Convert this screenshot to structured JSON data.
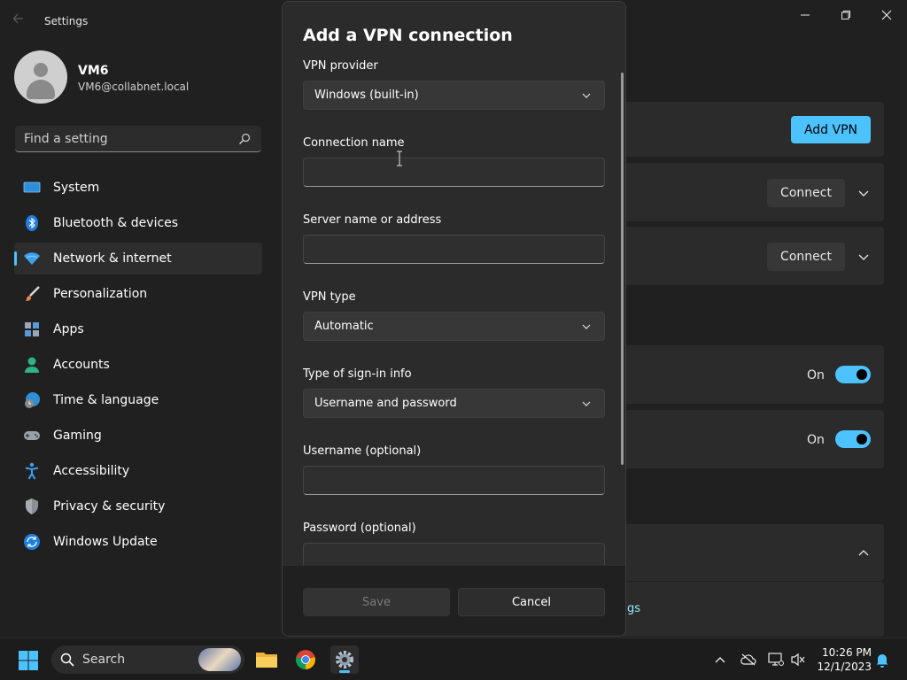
{
  "app": {
    "title": "Settings"
  },
  "window_controls": {
    "minimize": "minimize-icon",
    "maximize": "restore-icon",
    "close": "close-icon"
  },
  "profile": {
    "name": "VM6",
    "email": "VM6@collabnet.local"
  },
  "search": {
    "placeholder": "Find a setting"
  },
  "nav": {
    "items": [
      {
        "label": "System",
        "icon": "system-icon"
      },
      {
        "label": "Bluetooth & devices",
        "icon": "bluetooth-icon"
      },
      {
        "label": "Network & internet",
        "icon": "wifi-icon",
        "active": true
      },
      {
        "label": "Personalization",
        "icon": "brush-icon"
      },
      {
        "label": "Apps",
        "icon": "apps-icon"
      },
      {
        "label": "Accounts",
        "icon": "accounts-icon"
      },
      {
        "label": "Time & language",
        "icon": "clock-globe-icon"
      },
      {
        "label": "Gaming",
        "icon": "gamepad-icon"
      },
      {
        "label": "Accessibility",
        "icon": "accessibility-icon"
      },
      {
        "label": "Privacy & security",
        "icon": "shield-icon"
      },
      {
        "label": "Windows Update",
        "icon": "update-icon"
      }
    ]
  },
  "background": {
    "add_vpn_label": "Add VPN",
    "connect_label": "Connect",
    "toggle_on_label": "On",
    "link_fragment": "gs"
  },
  "dialog": {
    "title": "Add a VPN connection",
    "vpn_provider": {
      "label": "VPN provider",
      "value": "Windows (built-in)"
    },
    "connection_name": {
      "label": "Connection name",
      "value": ""
    },
    "server": {
      "label": "Server name or address",
      "value": ""
    },
    "vpn_type": {
      "label": "VPN type",
      "value": "Automatic"
    },
    "sign_in_type": {
      "label": "Type of sign-in info",
      "value": "Username and password"
    },
    "username": {
      "label": "Username (optional)",
      "value": ""
    },
    "password": {
      "label": "Password (optional)"
    },
    "save_label": "Save",
    "cancel_label": "Cancel"
  },
  "taskbar": {
    "search_label": "Search",
    "time": "10:26 PM",
    "date": "12/1/2023"
  },
  "colors": {
    "accent": "#4cc2ff",
    "background": "#202020",
    "dialog": "#2b2b2b"
  }
}
